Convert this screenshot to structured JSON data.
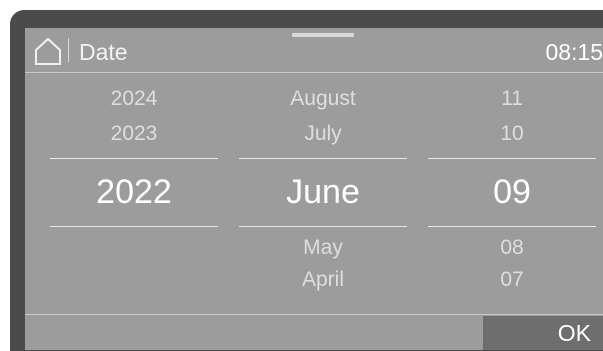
{
  "header": {
    "title": "Date",
    "time": "08:15",
    "home_icon": "home-icon"
  },
  "picker": {
    "year": {
      "above": [
        "2024",
        "2023"
      ],
      "selected": "2022",
      "below": []
    },
    "month": {
      "above": [
        "August",
        "July"
      ],
      "selected": "June",
      "below": [
        "May",
        "April"
      ]
    },
    "day": {
      "above": [
        "11",
        "10"
      ],
      "selected": "09",
      "below": [
        "08",
        "07"
      ]
    }
  },
  "footer": {
    "ok_label": "OK"
  },
  "colors": {
    "bezel": "#4b4b4b",
    "screen": "#9c9c9c",
    "ok_button": "#6e6e6e",
    "text": "#ffffff"
  }
}
